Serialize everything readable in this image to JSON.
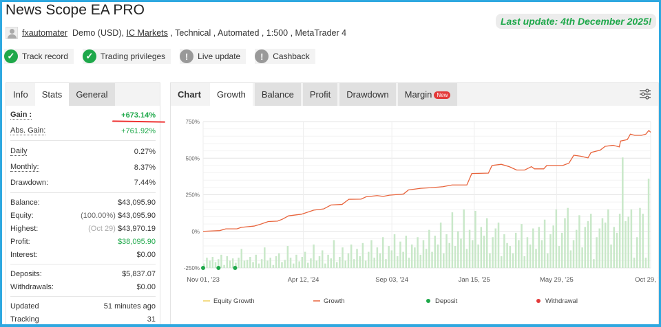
{
  "title": "News Scope EA PRO",
  "last_update": "Last update: 4th December 2025!",
  "meta": {
    "user": "fxautomater",
    "account": "Demo (USD),",
    "broker": "IC Markets",
    "rest": ", Technical , Automated , 1:500 , MetaTrader 4"
  },
  "chips": [
    {
      "label": "Track record",
      "icon": "check-icon"
    },
    {
      "label": "Trading privileges",
      "icon": "check-icon"
    },
    {
      "label": "Live update",
      "icon": "exclamation-icon"
    },
    {
      "label": "Cashback",
      "icon": "exclamation-icon"
    }
  ],
  "left_tabs": [
    "Info",
    "Stats",
    "General"
  ],
  "stats": {
    "gain": {
      "k": "Gain :",
      "v": "+673.14%"
    },
    "abs_gain": {
      "k": "Abs. Gain:",
      "v": "+761.92%"
    },
    "daily": {
      "k": "Daily",
      "v": "0.27%"
    },
    "monthly": {
      "k": "Monthly:",
      "v": "8.37%"
    },
    "drawdown": {
      "k": "Drawdown:",
      "v": "7.44%"
    },
    "balance": {
      "k": "Balance:",
      "v": "$43,095.90"
    },
    "equity": {
      "k": "Equity:",
      "pre": "(100.00%)",
      "v": "$43,095.90"
    },
    "highest": {
      "k": "Highest:",
      "pre": "(Oct 29)",
      "v": "$43,970.19"
    },
    "profit": {
      "k": "Profit:",
      "v": "$38,095.90"
    },
    "interest": {
      "k": "Interest:",
      "v": "$0.00"
    },
    "deposits": {
      "k": "Deposits:",
      "v": "$5,837.07"
    },
    "withdrawals": {
      "k": "Withdrawals:",
      "v": "$0.00"
    },
    "updated": {
      "k": "Updated",
      "v": "51 minutes ago"
    },
    "tracking": {
      "k": "Tracking",
      "v": "31"
    }
  },
  "right_tabs": [
    "Chart",
    "Growth",
    "Balance",
    "Profit",
    "Drawdown",
    "Margin"
  ],
  "new_badge": "New",
  "colors": {
    "growth": "#e8643c",
    "equity": "#f0d060",
    "deposit": "#1ea84a",
    "withdrawal": "#e33a3a",
    "bars": "#c9e8c9",
    "accent": "#1ea84a"
  },
  "chart_data": {
    "type": "line",
    "ylim": [
      -250,
      750
    ],
    "yticks": [
      "750%",
      "500%",
      "250%",
      "0%",
      "-250%"
    ],
    "yticks_values": [
      750,
      500,
      250,
      0,
      -250
    ],
    "xlim": [
      "2023-11-01",
      "2025-10-29"
    ],
    "xticks": [
      {
        "label": "Nov 01, '23",
        "date": "2023-11-01"
      },
      {
        "label": "Apr 12, '24",
        "date": "2024-04-12"
      },
      {
        "label": "Sep 03, '24",
        "date": "2024-09-03"
      },
      {
        "label": "Jan 15, '25",
        "date": "2025-01-15"
      },
      {
        "label": "May 29, '25",
        "date": "2025-05-29"
      },
      {
        "label": "Oct 29, '25",
        "date": "2025-10-29"
      }
    ],
    "legend": [
      "Equity Growth",
      "Growth",
      "Deposit",
      "Withdrawal"
    ],
    "legend_position": "bottom",
    "grid": true,
    "growth": [
      [
        "2023-11-01",
        0
      ],
      [
        "2023-11-28",
        5
      ],
      [
        "2023-12-08",
        17
      ],
      [
        "2023-12-26",
        17
      ],
      [
        "2024-01-02",
        27
      ],
      [
        "2024-01-23",
        36
      ],
      [
        "2024-02-02",
        48
      ],
      [
        "2024-02-15",
        67
      ],
      [
        "2024-03-01",
        70
      ],
      [
        "2024-03-09",
        83
      ],
      [
        "2024-03-19",
        106
      ],
      [
        "2024-04-09",
        117
      ],
      [
        "2024-04-29",
        145
      ],
      [
        "2024-05-15",
        153
      ],
      [
        "2024-05-27",
        180
      ],
      [
        "2024-06-14",
        184
      ],
      [
        "2024-06-25",
        219
      ],
      [
        "2024-07-15",
        220
      ],
      [
        "2024-07-23",
        236
      ],
      [
        "2024-08-10",
        244
      ],
      [
        "2024-08-20",
        239
      ],
      [
        "2024-08-30",
        247
      ],
      [
        "2024-09-22",
        255
      ],
      [
        "2024-09-30",
        283
      ],
      [
        "2024-10-20",
        294
      ],
      [
        "2024-11-05",
        298
      ],
      [
        "2024-11-25",
        305
      ],
      [
        "2024-12-10",
        317
      ],
      [
        "2025-01-03",
        317
      ],
      [
        "2025-01-11",
        395
      ],
      [
        "2025-02-07",
        398
      ],
      [
        "2025-02-13",
        450
      ],
      [
        "2025-02-28",
        458
      ],
      [
        "2025-03-13",
        442
      ],
      [
        "2025-03-25",
        419
      ],
      [
        "2025-04-07",
        419
      ],
      [
        "2025-04-18",
        442
      ],
      [
        "2025-04-23",
        427
      ],
      [
        "2025-05-08",
        427
      ],
      [
        "2025-05-13",
        450
      ],
      [
        "2025-06-08",
        450
      ],
      [
        "2025-06-18",
        466
      ],
      [
        "2025-06-26",
        520
      ],
      [
        "2025-07-08",
        513
      ],
      [
        "2025-07-19",
        502
      ],
      [
        "2025-07-24",
        539
      ],
      [
        "2025-08-08",
        555
      ],
      [
        "2025-08-16",
        581
      ],
      [
        "2025-08-29",
        588
      ],
      [
        "2025-09-08",
        577
      ],
      [
        "2025-09-10",
        617
      ],
      [
        "2025-09-21",
        627
      ],
      [
        "2025-09-26",
        664
      ],
      [
        "2025-10-03",
        656
      ],
      [
        "2025-10-14",
        656
      ],
      [
        "2025-10-21",
        664
      ],
      [
        "2025-10-26",
        689
      ],
      [
        "2025-10-29",
        677
      ]
    ],
    "deposits": [
      [
        "2023-11-01",
        -250
      ],
      [
        "2023-11-26",
        -250
      ],
      [
        "2023-12-23",
        -250
      ]
    ],
    "withdrawals": [],
    "bars": [
      -220,
      -180,
      -200,
      -175,
      -210,
      -190,
      -160,
      -230,
      -170,
      -200,
      -185,
      -215,
      -180,
      -120,
      -200,
      -195,
      -175,
      -210,
      -160,
      -220,
      -190,
      -110,
      -200,
      -180,
      -230,
      -170,
      -150,
      -210,
      -195,
      -100,
      -180,
      -220,
      -160,
      -205,
      -175,
      -140,
      -215,
      -185,
      -90,
      -200,
      -170,
      -130,
      -220,
      -160,
      -185,
      -60,
      -210,
      -175,
      -110,
      -200,
      -150,
      -90,
      -190,
      -120,
      -170,
      -80,
      -200,
      -140,
      -60,
      -180,
      -110,
      -150,
      -40,
      -190,
      -100,
      -130,
      -20,
      -170,
      -70,
      -140,
      -30,
      -180,
      -90,
      -110,
      -40,
      -160,
      -60,
      -120,
      10,
      -140,
      -30,
      -90,
      60,
      -150,
      -20,
      -80,
      130,
      -100,
      0,
      -50,
      150,
      -120,
      10,
      -60,
      140,
      -90,
      30,
      -30,
      90,
      -150,
      -40,
      20,
      60,
      -170,
      -20,
      -80,
      -100,
      -150,
      -10,
      -60,
      50,
      -170,
      -40,
      -90,
      20,
      -120,
      30,
      -60,
      80,
      -150,
      -20,
      40,
      150,
      -100,
      -10,
      90,
      160,
      -130,
      -60,
      10,
      110,
      -110,
      30,
      70,
      120,
      -190,
      -40,
      20,
      90,
      60,
      150,
      -90,
      30,
      -10,
      120,
      505,
      70,
      100,
      150,
      -180,
      -40,
      160,
      120,
      -180,
      360
    ]
  }
}
